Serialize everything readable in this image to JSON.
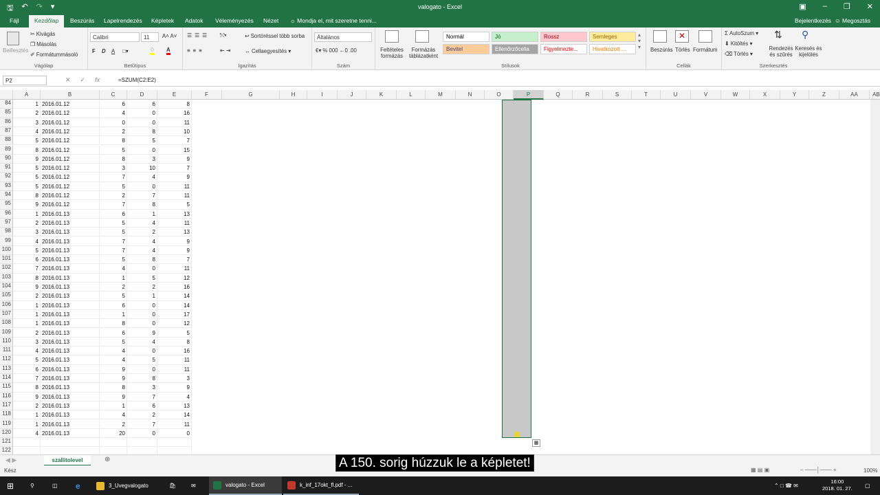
{
  "window": {
    "title": "valogato - Excel",
    "signin": "Bejelentkezés",
    "share": "Megosztás"
  },
  "tabs": [
    "Fájl",
    "Kezdőlap",
    "Beszúrás",
    "Lapelrendezés",
    "Képletek",
    "Adatok",
    "Véleményezés",
    "Nézet"
  ],
  "tellme": "Mondja el, mit szeretne tenni...",
  "ribbon": {
    "clipboard": {
      "paste": "Beillesztés",
      "cut": "Kivágás",
      "copy": "Másolás",
      "painter": "Formátummásoló",
      "label": "Vágólap"
    },
    "font": {
      "name": "Calibri",
      "size": "11",
      "bold": "F",
      "italic": "D",
      "underline": "A",
      "label": "Betűtípus"
    },
    "align": {
      "wrap": "Sortöréssel több sorba",
      "merge": "Cellaegyesítés",
      "label": "Igazítás"
    },
    "number": {
      "format": "Általános",
      "label": "Szám"
    },
    "styles": {
      "cond": "Feltételes formázás",
      "table": "Formázás táblázatként",
      "label": "Stílusok",
      "cells": [
        {
          "t": "Normál",
          "bg": "#ffffff",
          "fg": "#000000"
        },
        {
          "t": "Jó",
          "bg": "#c6efce",
          "fg": "#006100"
        },
        {
          "t": "Rossz",
          "bg": "#ffc7ce",
          "fg": "#9c0006"
        },
        {
          "t": "Semleges",
          "bg": "#ffeb9c",
          "fg": "#9c6500"
        },
        {
          "t": "Bevitel",
          "bg": "#ffcc99",
          "fg": "#3f3f76"
        },
        {
          "t": "Ellenőrzőcella",
          "bg": "#a5a5a5",
          "fg": "#ffffff"
        },
        {
          "t": "Figyelmezte...",
          "bg": "#ffffff",
          "fg": "#ff0000"
        },
        {
          "t": "Hivatkozott ...",
          "bg": "#ffffff",
          "fg": "#fa7d00"
        }
      ]
    },
    "cells": {
      "insert": "Beszúrás",
      "delete": "Törlés",
      "format": "Formátum",
      "label": "Cellák"
    },
    "editing": {
      "autosum": "AutoSzum",
      "fill": "Kitöltés",
      "clear": "Törlés",
      "sort": "Rendezés és szűrés",
      "find": "Keresés és kijelölés",
      "label": "Szerkesztés"
    }
  },
  "namebox": "P2",
  "formula": "=SZUM(C2:E2)",
  "columns": [
    "A",
    "B",
    "C",
    "D",
    "E",
    "F",
    "G",
    "H",
    "I",
    "J",
    "K",
    "L",
    "M",
    "N",
    "O",
    "P",
    "Q",
    "R",
    "S",
    "T",
    "U",
    "V",
    "W",
    "X",
    "Y",
    "Z",
    "AA",
    "AB"
  ],
  "rows": [
    {
      "n": "84",
      "a": "1",
      "b": "2016.01.12",
      "c": "6",
      "d": "6",
      "e": "8"
    },
    {
      "n": "85",
      "a": "2",
      "b": "2016.01.12",
      "c": "4",
      "d": "0",
      "e": "16"
    },
    {
      "n": "86",
      "a": "3",
      "b": "2016.01.12",
      "c": "0",
      "d": "0",
      "e": "11"
    },
    {
      "n": "87",
      "a": "4",
      "b": "2016.01.12",
      "c": "2",
      "d": "8",
      "e": "10"
    },
    {
      "n": "88",
      "a": "5",
      "b": "2016.01.12",
      "c": "8",
      "d": "5",
      "e": "7"
    },
    {
      "n": "89",
      "a": "8",
      "b": "2016.01.12",
      "c": "5",
      "d": "0",
      "e": "15"
    },
    {
      "n": "90",
      "a": "9",
      "b": "2016.01.12",
      "c": "8",
      "d": "3",
      "e": "9"
    },
    {
      "n": "91",
      "a": "5",
      "b": "2016.01.12",
      "c": "3",
      "d": "10",
      "e": "7"
    },
    {
      "n": "92",
      "a": "5",
      "b": "2016.01.12",
      "c": "7",
      "d": "4",
      "e": "9"
    },
    {
      "n": "93",
      "a": "5",
      "b": "2016.01.12",
      "c": "5",
      "d": "0",
      "e": "11"
    },
    {
      "n": "94",
      "a": "8",
      "b": "2016.01.12",
      "c": "2",
      "d": "7",
      "e": "11"
    },
    {
      "n": "95",
      "a": "9",
      "b": "2016.01.12",
      "c": "7",
      "d": "8",
      "e": "5"
    },
    {
      "n": "96",
      "a": "1",
      "b": "2016.01.13",
      "c": "6",
      "d": "1",
      "e": "13"
    },
    {
      "n": "97",
      "a": "2",
      "b": "2016.01.13",
      "c": "5",
      "d": "4",
      "e": "11"
    },
    {
      "n": "98",
      "a": "3",
      "b": "2016.01.13",
      "c": "5",
      "d": "2",
      "e": "13"
    },
    {
      "n": "99",
      "a": "4",
      "b": "2016.01.13",
      "c": "7",
      "d": "4",
      "e": "9"
    },
    {
      "n": "100",
      "a": "5",
      "b": "2016.01.13",
      "c": "7",
      "d": "4",
      "e": "9"
    },
    {
      "n": "101",
      "a": "6",
      "b": "2016.01.13",
      "c": "5",
      "d": "8",
      "e": "7"
    },
    {
      "n": "102",
      "a": "7",
      "b": "2016.01.13",
      "c": "4",
      "d": "0",
      "e": "11"
    },
    {
      "n": "103",
      "a": "8",
      "b": "2016.01.13",
      "c": "1",
      "d": "5",
      "e": "12"
    },
    {
      "n": "104",
      "a": "9",
      "b": "2016.01.13",
      "c": "2",
      "d": "2",
      "e": "16"
    },
    {
      "n": "105",
      "a": "2",
      "b": "2016.01.13",
      "c": "5",
      "d": "1",
      "e": "14"
    },
    {
      "n": "106",
      "a": "1",
      "b": "2016.01.13",
      "c": "6",
      "d": "0",
      "e": "14"
    },
    {
      "n": "107",
      "a": "1",
      "b": "2016.01.13",
      "c": "1",
      "d": "0",
      "e": "17"
    },
    {
      "n": "108",
      "a": "1",
      "b": "2016.01.13",
      "c": "8",
      "d": "0",
      "e": "12"
    },
    {
      "n": "109",
      "a": "2",
      "b": "2016.01.13",
      "c": "6",
      "d": "9",
      "e": "5"
    },
    {
      "n": "110",
      "a": "3",
      "b": "2016.01.13",
      "c": "5",
      "d": "4",
      "e": "8"
    },
    {
      "n": "111",
      "a": "4",
      "b": "2016.01.13",
      "c": "4",
      "d": "0",
      "e": "16"
    },
    {
      "n": "112",
      "a": "5",
      "b": "2016.01.13",
      "c": "4",
      "d": "5",
      "e": "11"
    },
    {
      "n": "113",
      "a": "6",
      "b": "2016.01.13",
      "c": "9",
      "d": "0",
      "e": "11"
    },
    {
      "n": "114",
      "a": "7",
      "b": "2016.01.13",
      "c": "9",
      "d": "8",
      "e": "3"
    },
    {
      "n": "115",
      "a": "8",
      "b": "2016.01.13",
      "c": "8",
      "d": "3",
      "e": "9"
    },
    {
      "n": "116",
      "a": "9",
      "b": "2016.01.13",
      "c": "9",
      "d": "7",
      "e": "4"
    },
    {
      "n": "117",
      "a": "2",
      "b": "2016.01.13",
      "c": "1",
      "d": "6",
      "e": "13"
    },
    {
      "n": "118",
      "a": "1",
      "b": "2016.01.13",
      "c": "4",
      "d": "2",
      "e": "14"
    },
    {
      "n": "119",
      "a": "1",
      "b": "2016.01.13",
      "c": "2",
      "d": "7",
      "e": "11"
    },
    {
      "n": "120",
      "a": "4",
      "b": "2016.01.13",
      "c": "20",
      "d": "0",
      "e": "0"
    },
    {
      "n": "121",
      "a": "",
      "b": "",
      "c": "",
      "d": "",
      "e": ""
    },
    {
      "n": "122",
      "a": "",
      "b": "",
      "c": "",
      "d": "",
      "e": ""
    }
  ],
  "sheet": {
    "name": "szallitolevel"
  },
  "status": {
    "mode": "Kész",
    "zoom": "100%"
  },
  "taskbar": {
    "items": [
      "3_Uvegvalogato",
      "valogato - Excel",
      "k_inf_17okt_fl.pdf - ..."
    ],
    "time": "16:00",
    "date": "2018. 01. 27."
  },
  "caption": "A 150. sorig húzzuk le a képletet!"
}
